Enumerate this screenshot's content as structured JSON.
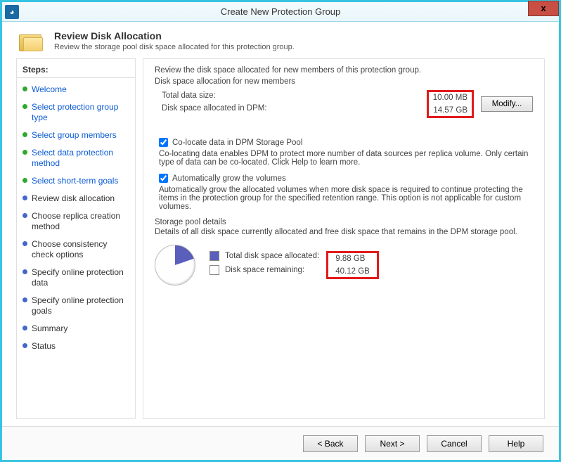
{
  "window": {
    "title": "Create New Protection Group",
    "close_label": "x"
  },
  "header": {
    "title": "Review Disk Allocation",
    "subtitle": "Review the storage pool disk space allocated for this protection group."
  },
  "steps": {
    "header": "Steps:",
    "items": [
      {
        "label": "Welcome",
        "state": "done",
        "link": true
      },
      {
        "label": "Select protection group type",
        "state": "done",
        "link": true
      },
      {
        "label": "Select group members",
        "state": "done",
        "link": true
      },
      {
        "label": "Select data protection method",
        "state": "done",
        "link": true
      },
      {
        "label": "Select short-term goals",
        "state": "done",
        "link": true
      },
      {
        "label": "Review disk allocation",
        "state": "current",
        "link": false
      },
      {
        "label": "Choose replica creation method",
        "state": "pending",
        "link": true
      },
      {
        "label": "Choose consistency check options",
        "state": "pending",
        "link": false
      },
      {
        "label": "Specify online protection data",
        "state": "pending",
        "link": false
      },
      {
        "label": "Specify online protection goals",
        "state": "pending",
        "link": false
      },
      {
        "label": "Summary",
        "state": "pending",
        "link": false
      },
      {
        "label": "Status",
        "state": "pending",
        "link": false
      }
    ]
  },
  "content": {
    "intro": "Review the disk space allocated for new members of this protection group.",
    "allocation": {
      "legend": "Disk space allocation for new members",
      "total_size_label": "Total data size:",
      "total_size_value": "10.00 MB",
      "allocated_label": "Disk space allocated in DPM:",
      "allocated_value": "14.57 GB",
      "modify_button": "Modify..."
    },
    "colocate": {
      "checked": true,
      "label": "Co-locate data in DPM Storage Pool",
      "explain": "Co-locating data enables DPM to protect more number of data sources per replica volume. Only certain type of data can be co-located. Click Help to learn more."
    },
    "autogrow": {
      "checked": true,
      "label": "Automatically grow the volumes",
      "explain": "Automatically grow the allocated volumes when more disk space is required to continue protecting the items in the protection group for the specified retention range. This option is not applicable for custom volumes."
    },
    "pool": {
      "legend": "Storage pool details",
      "description": "Details of all disk space currently allocated and free disk space that remains in the DPM storage pool.",
      "allocated_label": "Total disk space allocated:",
      "allocated_value": "9.88 GB",
      "remaining_label": "Disk space remaining:",
      "remaining_value": "40.12 GB"
    }
  },
  "chart_data": {
    "type": "pie",
    "title": "Storage pool usage",
    "series": [
      {
        "name": "Total disk space allocated",
        "value": 9.88,
        "unit": "GB",
        "color": "#5a5fbc"
      },
      {
        "name": "Disk space remaining",
        "value": 40.12,
        "unit": "GB",
        "color": "#ffffff"
      }
    ]
  },
  "footer": {
    "back": "< Back",
    "next": "Next >",
    "cancel": "Cancel",
    "help": "Help"
  }
}
